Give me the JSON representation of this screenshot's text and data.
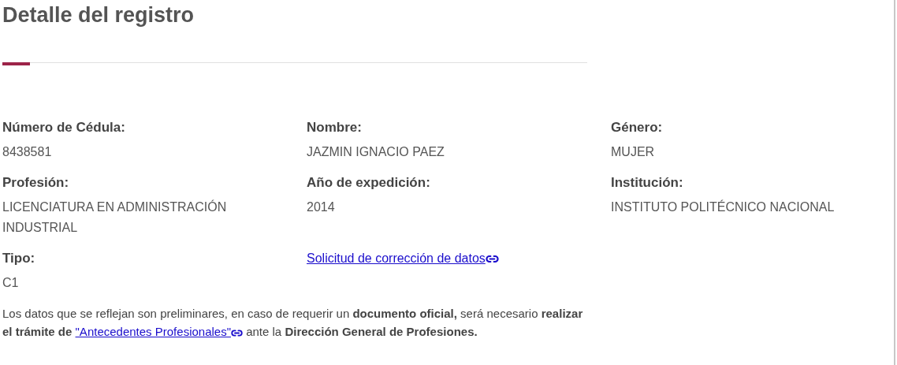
{
  "title": "Detalle del registro",
  "fields": [
    {
      "kind": "field",
      "label": "Número de Cédula:",
      "values": [
        "8438581"
      ]
    },
    {
      "kind": "field",
      "label": "Nombre:",
      "values": [
        "JAZMIN IGNACIO PAEZ"
      ]
    },
    {
      "kind": "field",
      "label": "Género:",
      "values": [
        "MUJER"
      ]
    },
    {
      "kind": "field",
      "label": "Profesión:",
      "values": [
        "LICENCIATURA EN ADMINISTRACIÓN",
        "INDUSTRIAL"
      ]
    },
    {
      "kind": "field",
      "label": "Año de expedición:",
      "values": [
        "2014"
      ]
    },
    {
      "kind": "field",
      "label": "Institución:",
      "values": [
        "INSTITUTO POLITÉCNICO NACIONAL"
      ]
    },
    {
      "kind": "field",
      "label": "Tipo:",
      "values": [
        "C1"
      ]
    },
    {
      "kind": "link",
      "text": "Solicitud de corrección de datos"
    }
  ],
  "note": {
    "before": "Los datos que se reflejan son preliminares, en caso de requerir un **documento oficial,** será necesario **realizar el trámite de**",
    "link": "\"Antecedentes Profesionales\"",
    "after": "ante la **Dirección General de Profesiones.**"
  }
}
